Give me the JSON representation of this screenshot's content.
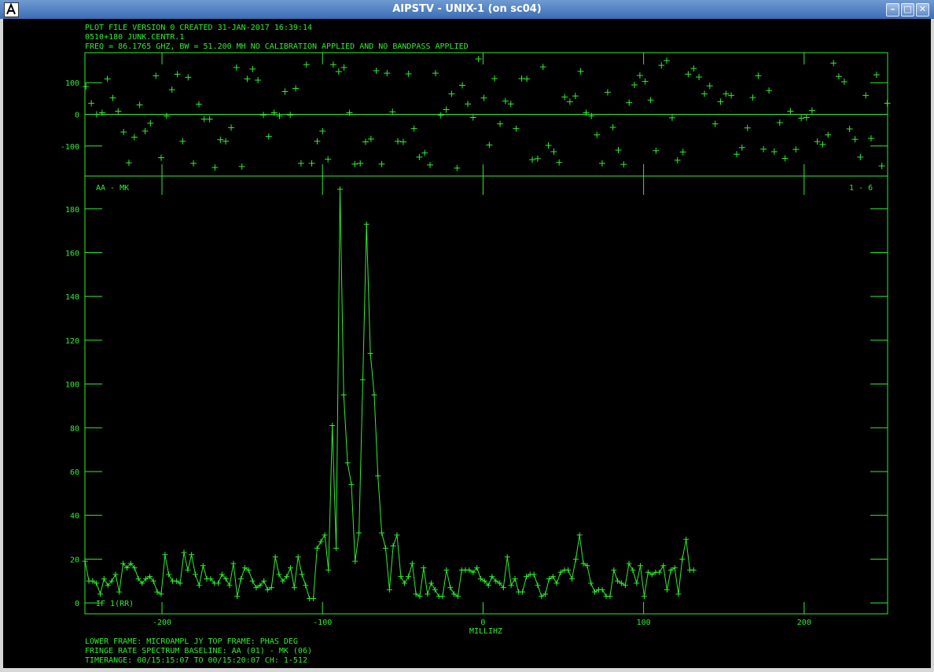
{
  "window": {
    "title": "AIPSTV - UNIX-1 (on sc04)",
    "minimize_icon": "minimize-icon",
    "maximize_icon": "maximize-icon",
    "close_icon": "close-icon",
    "app_icon": "aips-app-icon"
  },
  "header": {
    "line1": "PLOT FILE VERSION 0  CREATED 31-JAN-2017 16:39:14",
    "line2": "0510+180   JUNK.CENTR.1",
    "line3": "FREQ = 86.1765 GHZ, BW = 51.200 MH   NO CALIBRATION APPLIED AND NO BANDPASS APPLIED"
  },
  "footer": {
    "line1": "LOWER FRAME: MICROAMPL JY   TOP FRAME: PHAS DEG",
    "line2": "FRINGE RATE SPECTRUM    BASELINE: AA (01) - MK (06)",
    "line3": "TIMERANGE: 00/15:15:07 TO 00/15:20:07 CH: 1-512"
  },
  "labels": {
    "baseline": "AA - MK",
    "range": "1 - 6",
    "if_label": "IF 1(RR)"
  },
  "colors": {
    "plot": "#2cf02c",
    "background": "#000000"
  },
  "chart_data": {
    "type": "line",
    "xlabel": "MILLIHZ",
    "xlim": [
      -248,
      252
    ],
    "x_ticks": [
      -200,
      -100,
      0,
      100,
      200
    ],
    "x_tick_labels": [
      "-200",
      "-100",
      "0",
      "100",
      "200"
    ],
    "phase_panel": {
      "type": "scatter",
      "ylabel": "PHAS DEG",
      "ylim": [
        -195,
        195
      ],
      "y_ticks": [
        100,
        0,
        -100
      ],
      "y_tick_labels": [
        "100",
        "0",
        "-100"
      ],
      "series": [
        {
          "x": [
            -247.4,
            -244.0,
            -240.7,
            -237.3,
            -234.0,
            -230.6,
            -227.3,
            -223.9,
            -220.6,
            -217.2,
            -213.9,
            -210.5,
            -207.2,
            -203.8,
            -200.5,
            -197.1,
            -193.8,
            -190.4,
            -187.1,
            -183.7,
            -180.4,
            -177.0,
            -173.7,
            -170.3,
            -167.0,
            -163.6,
            -160.3,
            -156.9,
            -153.6,
            -150.2,
            -146.9,
            -143.5,
            -140.2,
            -136.8,
            -133.5,
            -130.1,
            -126.8,
            -123.4,
            -120.1,
            -116.7,
            -113.4,
            -110.0,
            -106.7,
            -103.3,
            -100.0,
            -96.6,
            -93.3,
            -89.9,
            -86.6,
            -83.2,
            -79.9,
            -76.5,
            -73.2,
            -69.8,
            -66.5,
            -63.1,
            -59.8,
            -56.4,
            -53.1,
            -49.7,
            -46.4,
            -43.0,
            -39.7,
            -36.3,
            -33.0,
            -29.6,
            -26.3,
            -22.9,
            -19.6,
            -16.2,
            -12.9,
            -9.5,
            -6.2,
            -2.8,
            0.5,
            3.9,
            7.2,
            10.6,
            13.9,
            17.3,
            20.6,
            24.0,
            27.3,
            30.7,
            34.0,
            37.4,
            40.7,
            44.1,
            47.4,
            50.8,
            54.1,
            57.5,
            60.8,
            64.2,
            67.5,
            70.9,
            74.2,
            77.6,
            80.9,
            84.3,
            87.6,
            91.0,
            94.3,
            97.7,
            101.0,
            104.4,
            107.7,
            111.1,
            114.4,
            117.8,
            121.1,
            124.5,
            127.8,
            131.2,
            134.5,
            137.9,
            141.2,
            144.6,
            147.9,
            151.3,
            154.6,
            158.0,
            161.3,
            164.7,
            168.0,
            171.4,
            174.7,
            178.1,
            181.4,
            184.8,
            188.1,
            191.5,
            194.8,
            198.2,
            201.5,
            204.9,
            208.2,
            211.6,
            214.9,
            218.3,
            221.6,
            225.0,
            228.3,
            231.7,
            235.0,
            238.4,
            241.7,
            245.1,
            248.4,
            251.8
          ],
          "y": [
            88,
            35,
            0,
            5,
            112,
            52,
            10,
            -56,
            -153,
            -72,
            30,
            -53,
            -28,
            122,
            -137,
            -5,
            78,
            127,
            -85,
            117,
            -155,
            32,
            -15,
            -15,
            -168,
            -80,
            -85,
            -42,
            148,
            -165,
            112,
            143,
            108,
            -2,
            -70,
            5,
            -5,
            72,
            -2,
            82,
            -155,
            157,
            -155,
            -85,
            -53,
            -142,
            157,
            135,
            148,
            5,
            -157,
            -155,
            -87,
            -78,
            138,
            -157,
            130,
            8,
            -85,
            -87,
            128,
            -45,
            -135,
            -122,
            -160,
            130,
            -3,
            15,
            65,
            -170,
            92,
            33,
            -10,
            175,
            52,
            -97,
            113,
            -30,
            42,
            33,
            -45,
            113,
            112,
            -143,
            -140,
            150,
            -98,
            -118,
            -152,
            55,
            40,
            58,
            136,
            5,
            -5,
            -65,
            -155,
            70,
            -41,
            -113,
            -158,
            37,
            93,
            123,
            104,
            45,
            -115,
            155,
            170,
            -11,
            -145,
            -119,
            127,
            145,
            118,
            65,
            90,
            -30,
            40,
            65,
            60,
            -126,
            -105,
            -43,
            53,
            122,
            -110,
            75,
            -118,
            -26,
            -139,
            10,
            -111,
            -12,
            -10,
            12,
            -86,
            -95,
            -65,
            162,
            120,
            103,
            -46,
            -79,
            -135,
            60,
            -76,
            125,
            -163,
            35
          ]
        }
      ]
    },
    "amplitude_panel": {
      "type": "line",
      "ylabel": "MICROAMPL JY",
      "ylim": [
        -5,
        195
      ],
      "y_ticks": [
        0,
        20,
        40,
        60,
        80,
        100,
        120,
        140,
        160,
        180
      ],
      "y_tick_labels": [
        "0",
        "20",
        "40",
        "60",
        "80",
        "100",
        "120",
        "140",
        "160",
        "180"
      ],
      "series": [
        {
          "x": [
            -247.9,
            -245.5,
            -243.2,
            -240.8,
            -238.4,
            -236.1,
            -233.7,
            -231.3,
            -228.9,
            -226.6,
            -224.2,
            -221.8,
            -219.5,
            -217.1,
            -214.7,
            -212.4,
            -210.0,
            -207.6,
            -205.3,
            -202.9,
            -200.5,
            -198.1,
            -195.8,
            -193.4,
            -191.0,
            -188.7,
            -186.3,
            -183.9,
            -181.6,
            -179.2,
            -176.8,
            -174.4,
            -172.1,
            -169.7,
            -167.3,
            -165.0,
            -162.6,
            -160.2,
            -157.9,
            -155.5,
            -153.1,
            -150.8,
            -148.4,
            -146.0,
            -143.6,
            -141.3,
            -138.9,
            -136.5,
            -134.2,
            -131.8,
            -129.4,
            -127.1,
            -124.7,
            -122.3,
            -119.9,
            -117.6,
            -115.2,
            -112.8,
            -110.5,
            -108.1,
            -105.7,
            -103.4,
            -101.0,
            -98.6,
            -96.3,
            -93.9,
            -91.5,
            -89.1,
            -86.8,
            -84.4,
            -82.0,
            -79.7,
            -77.3,
            -74.9,
            -72.6,
            -70.2,
            -67.8,
            -65.5,
            -63.1,
            -60.7,
            -58.3,
            -56.0,
            -53.6,
            -51.2,
            -48.9,
            -46.5,
            -44.1,
            -41.8,
            -39.4,
            -37.0,
            -34.6,
            -32.3,
            -29.9,
            -27.5,
            -25.2,
            -22.8,
            -20.4,
            -18.1,
            -15.7,
            -13.3,
            -11.0,
            -8.6,
            -6.2,
            -3.8,
            -1.5,
            0.9,
            3.3,
            5.6,
            8.0,
            10.4,
            12.7,
            15.1,
            17.5,
            19.9,
            22.2,
            24.6,
            27.0,
            29.3,
            31.7,
            34.1,
            36.4,
            38.8,
            41.2,
            43.5,
            45.9,
            48.3,
            50.7,
            53.0,
            55.4,
            57.8,
            60.1,
            62.5,
            64.9,
            67.2,
            69.6,
            72.0,
            74.3,
            76.7,
            79.1,
            81.5,
            83.8,
            86.2,
            88.6,
            90.9,
            93.3,
            95.7,
            98.0,
            100.4,
            102.8,
            105.2,
            107.5,
            109.9,
            112.3,
            114.6,
            117.0,
            119.4,
            121.7,
            124.1,
            126.5,
            128.8,
            131.2,
            133.6,
            136.0,
            138.3,
            140.7,
            143.1,
            145.4,
            147.8,
            150.2,
            152.5,
            154.9,
            157.3,
            159.6,
            162.0,
            164.4,
            166.8,
            169.1,
            171.5,
            173.9,
            176.2,
            178.6,
            181.0,
            183.3,
            185.7,
            188.1,
            190.4,
            192.8,
            195.2,
            197.6,
            199.9,
            202.3,
            204.7,
            207.0,
            209.4,
            211.8,
            214.1,
            216.5,
            218.9,
            221.3,
            223.6,
            226.0,
            228.4,
            230.7,
            233.1,
            235.5,
            237.8,
            240.2,
            242.6,
            244.9,
            247.3,
            249.7,
            252.0
          ],
          "y": [
            19,
            10,
            10,
            9,
            4,
            11,
            8,
            10,
            13,
            5,
            18,
            16,
            18,
            16,
            11,
            9,
            11,
            12,
            10,
            5,
            4,
            22,
            13,
            10,
            10,
            9,
            23,
            15,
            22,
            13,
            8,
            17,
            11,
            11,
            9,
            9,
            13,
            11,
            8,
            18,
            3,
            11,
            16,
            15,
            10,
            7,
            8,
            10,
            6,
            7,
            21,
            13,
            10,
            12,
            16,
            7,
            21,
            13,
            8,
            2,
            2,
            25,
            28,
            31,
            15,
            81,
            25,
            189,
            95,
            64,
            54,
            19,
            32,
            102,
            173,
            114,
            95,
            58,
            32,
            25,
            6,
            26,
            31,
            12,
            9,
            12,
            18,
            4,
            3,
            16,
            4,
            9,
            6,
            3,
            3,
            15,
            7,
            4,
            3,
            15,
            15,
            15,
            14,
            16,
            11,
            10,
            8,
            12,
            10,
            9,
            7,
            21,
            8,
            11,
            5,
            5,
            12,
            13,
            13,
            8,
            3,
            4,
            11,
            12,
            9,
            14,
            15,
            15,
            11,
            20,
            31,
            18,
            17,
            9,
            5,
            6,
            6,
            3,
            3,
            15,
            10,
            9,
            8,
            18,
            15,
            9,
            17,
            3,
            14,
            13,
            14,
            14,
            17,
            6,
            15,
            16,
            4,
            20,
            29,
            15,
            15
          ]
        }
      ]
    }
  }
}
